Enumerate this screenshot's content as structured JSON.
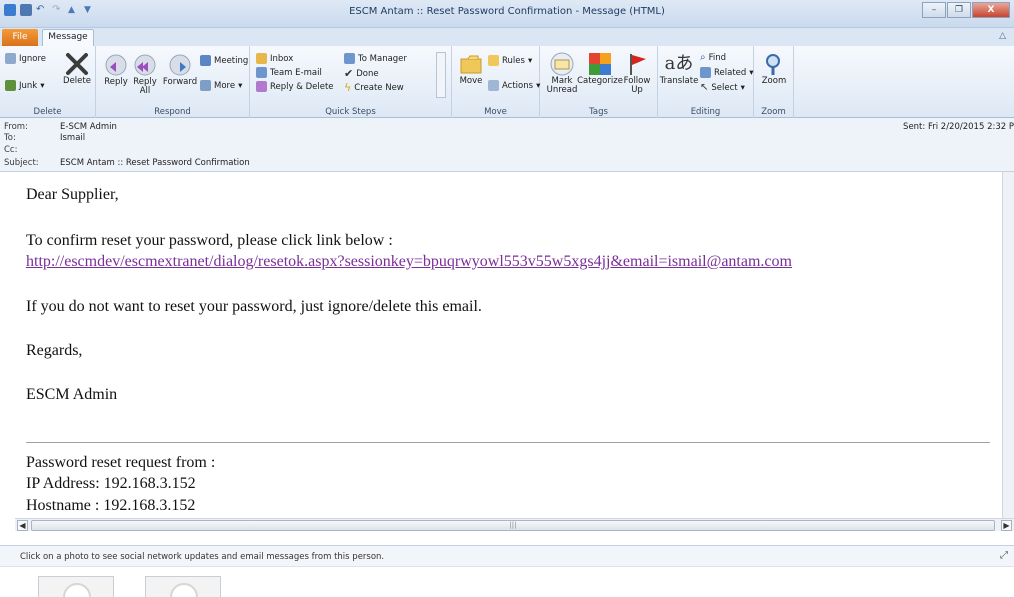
{
  "window": {
    "title": "ESCM Antam :: Reset Password Confirmation - Message (HTML)",
    "buttons": {
      "minimize": "–",
      "restore": "❐",
      "close": "X"
    }
  },
  "tabs": {
    "file": "File",
    "message": "Message"
  },
  "ribbon": {
    "groups": {
      "delete": "Delete",
      "respond": "Respond",
      "quick_steps": "Quick Steps",
      "move": "Move",
      "tags": "Tags",
      "editing": "Editing",
      "zoom": "Zoom"
    },
    "delete": {
      "ignore": "Ignore",
      "junk": "Junk",
      "delete": "Delete"
    },
    "respond": {
      "reply": "Reply",
      "reply_all": "Reply All",
      "forward": "Forward",
      "meeting": "Meeting",
      "more": "More"
    },
    "quick_steps": {
      "inbox": "Inbox",
      "team_email": "Team E-mail",
      "reply_delete": "Reply & Delete",
      "to_manager": "To Manager",
      "done": "Done",
      "create_new": "Create New"
    },
    "move": {
      "move": "Move",
      "rules": "Rules",
      "actions": "Actions"
    },
    "tags": {
      "mark_unread": "Mark Unread",
      "categorize": "Categorize",
      "follow_up": "Follow Up"
    },
    "editing": {
      "translate": "Translate",
      "find": "Find",
      "related": "Related",
      "select": "Select"
    },
    "zoom": {
      "zoom": "Zoom"
    }
  },
  "header": {
    "from_label": "From:",
    "from_value": "E-SCM Admin",
    "to_label": "To:",
    "to_value": "Ismail",
    "cc_label": "Cc:",
    "cc_value": "",
    "subject_label": "Subject:",
    "subject_value": "ESCM Antam :: Reset Password Confirmation",
    "sent": "Sent:  Fri 2/20/2015 2:32 P"
  },
  "body": {
    "greeting": "Dear Supplier,",
    "instruction": "To confirm reset your password, please click link below :",
    "link": "http://escmdev/escmextranet/dialog/resetok.aspx?sessionkey=bpuqrwyowl553v55w5xgs4jj&email=ismail@antam.com",
    "ignore_note": "If you do not want to reset your password, just ignore/delete this email.",
    "regards": "Regards,",
    "signature": "ESCM Admin",
    "request_from": "Password reset request from :",
    "ip_address": "IP Address: 192.168.3.152",
    "hostname": "Hostname : 192.168.3.152"
  },
  "people_pane": {
    "text": "Click on a photo to see social network updates and email messages from this person."
  },
  "colors": {
    "link": "#7b2d98",
    "file_tab": "#e8821f",
    "close": "#c8432f"
  }
}
